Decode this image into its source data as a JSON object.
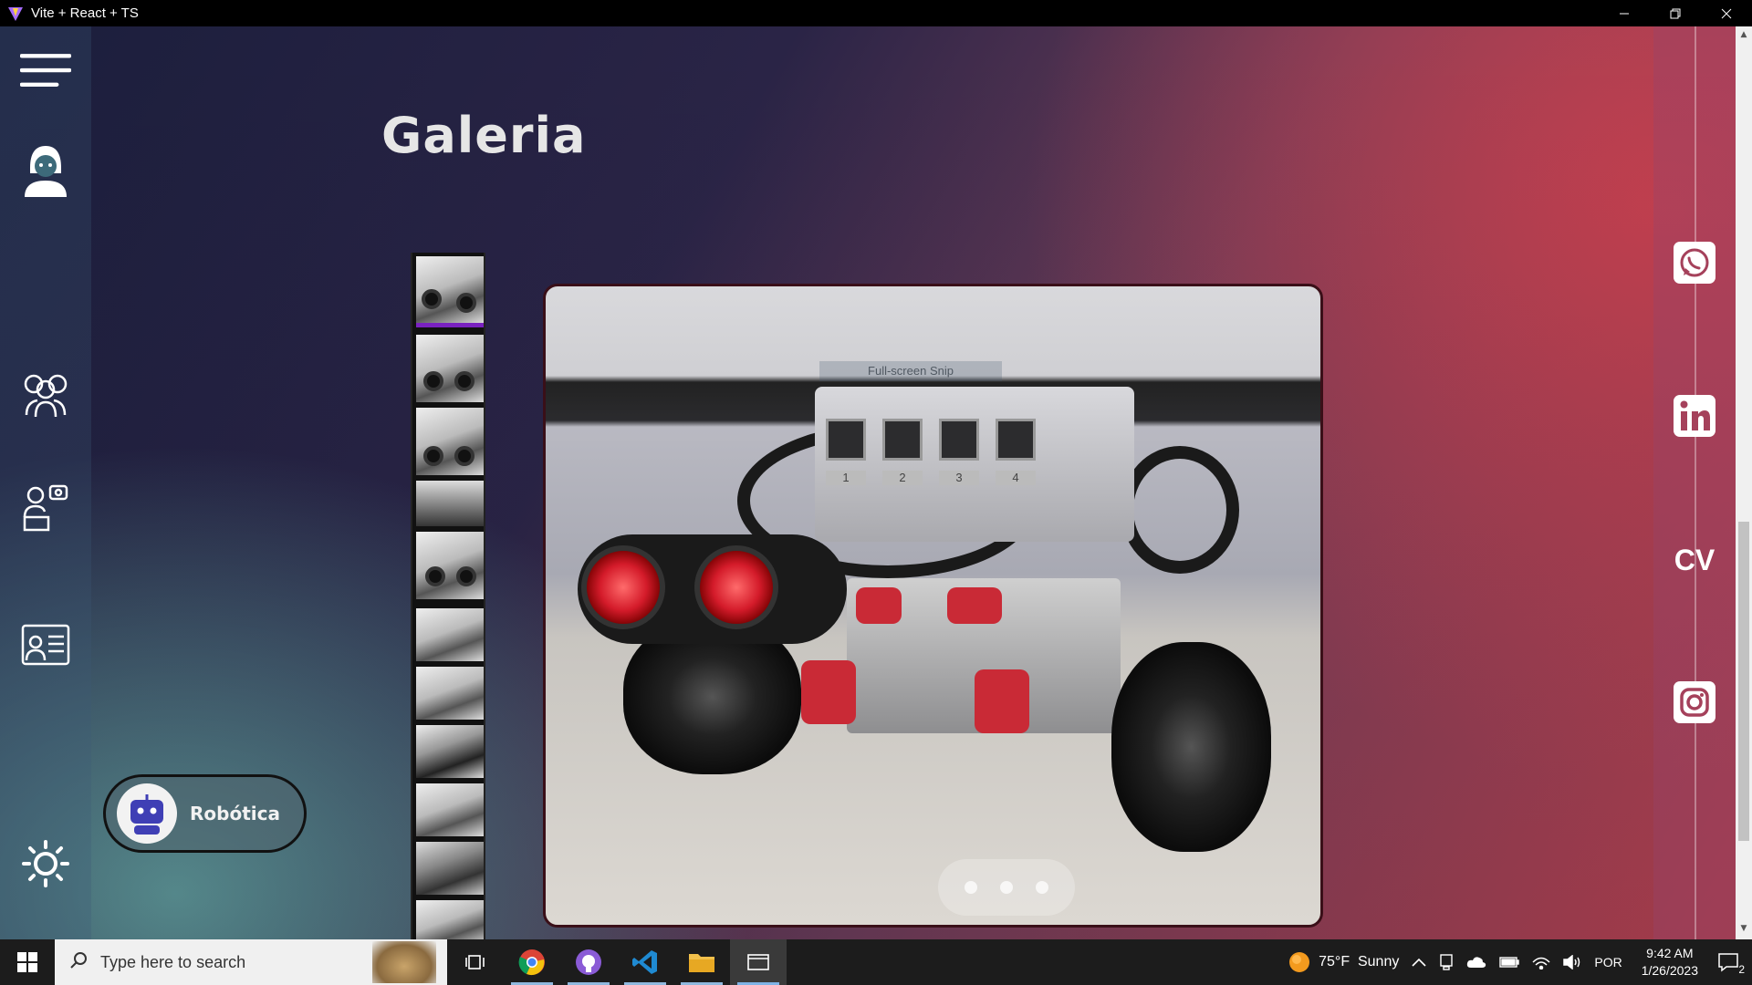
{
  "window": {
    "title": "Vite + React + TS"
  },
  "sidebar": {
    "icons": [
      "menu-icon",
      "person-avatar-icon",
      "team-icon",
      "developer-icon",
      "resume-icon",
      "theme-toggle-icon"
    ]
  },
  "gallery": {
    "title": "Galeria",
    "thumbnail_count": 12,
    "active_thumbnail": 1,
    "slide_count": 3,
    "overlay_text": "Full-screen Snip",
    "port_labels": [
      "1",
      "2",
      "3",
      "4"
    ],
    "category": {
      "label": "Robótica",
      "icon": "robot-icon"
    }
  },
  "social": {
    "links": [
      {
        "name": "whatsapp",
        "icon": "whatsapp-icon"
      },
      {
        "name": "linkedin",
        "icon": "linkedin-icon"
      },
      {
        "name": "cv",
        "label": "CV"
      },
      {
        "name": "instagram",
        "icon": "instagram-icon"
      }
    ]
  },
  "taskbar": {
    "search_placeholder": "Type here to search",
    "weather": {
      "temp": "75°F",
      "condition": "Sunny"
    },
    "language": "POR",
    "time": "9:42 AM",
    "date": "1/26/2023",
    "notifications": "2",
    "apps": [
      "task-view-icon",
      "chrome-icon",
      "github-desktop-icon",
      "vscode-icon",
      "file-explorer-icon",
      "terminal-icon"
    ]
  }
}
